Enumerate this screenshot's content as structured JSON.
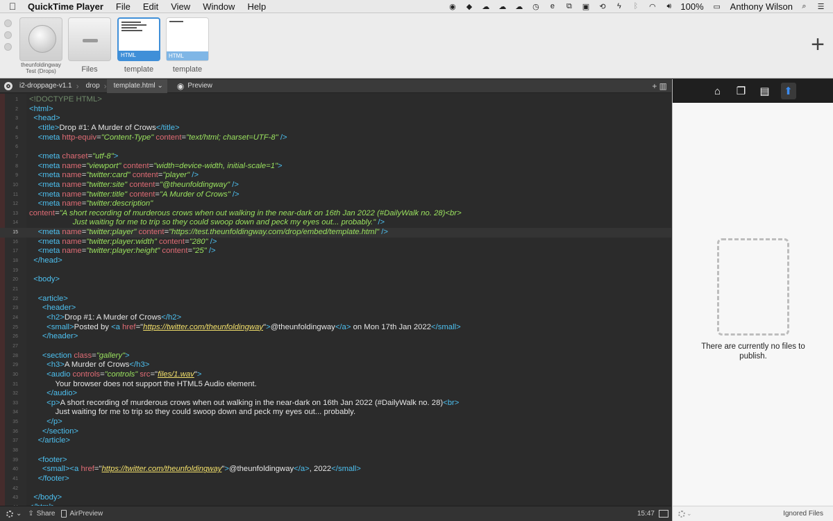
{
  "menubar": {
    "app_name": "QuickTime Player",
    "menus": [
      "File",
      "Edit",
      "View",
      "Window",
      "Help"
    ],
    "battery": "100%",
    "user": "Anthony Wilson"
  },
  "strip": {
    "tiles": [
      {
        "caption": "theunfoldingway\nTest (Drops)",
        "icon": "globe-icon"
      },
      {
        "caption": "Files",
        "icon": "files-box-icon"
      },
      {
        "caption": "template",
        "badge": "HTML",
        "icon": "html-doc-icon",
        "selected": true
      },
      {
        "caption": "template",
        "badge": "HTML",
        "icon": "html-doc-icon",
        "selected": false
      }
    ]
  },
  "editor_bar": {
    "crumbs": [
      "i2-droppage-v1.1",
      "drop",
      "template.html"
    ],
    "preview": "Preview"
  },
  "code": {
    "current_line": 15,
    "lines": [
      [
        [
          "c",
          "<!DOCTYPE HTML>"
        ]
      ],
      [
        [
          "t",
          "<html>"
        ]
      ],
      [
        [
          "x",
          "  "
        ],
        [
          "t",
          "<head>"
        ]
      ],
      [
        [
          "x",
          "    "
        ],
        [
          "t",
          "<title>"
        ],
        [
          "x",
          "Drop #1: A Murder of Crows"
        ],
        [
          "t",
          "</title>"
        ]
      ],
      [
        [
          "x",
          "    "
        ],
        [
          "t",
          "<meta "
        ],
        [
          "a",
          "http-equiv"
        ],
        [
          "x",
          "="
        ],
        [
          "v",
          "\"Content-Type\""
        ],
        [
          "x",
          " "
        ],
        [
          "a",
          "content"
        ],
        [
          "x",
          "="
        ],
        [
          "v",
          "\"text/html; charset=UTF-8\""
        ],
        [
          "t",
          " />"
        ]
      ],
      [],
      [
        [
          "x",
          "    "
        ],
        [
          "t",
          "<meta "
        ],
        [
          "a",
          "charset"
        ],
        [
          "x",
          "="
        ],
        [
          "v",
          "\"utf-8\""
        ],
        [
          "t",
          ">"
        ]
      ],
      [
        [
          "x",
          "    "
        ],
        [
          "t",
          "<meta "
        ],
        [
          "a",
          "name"
        ],
        [
          "x",
          "="
        ],
        [
          "v",
          "\"viewport\""
        ],
        [
          "x",
          " "
        ],
        [
          "a",
          "content"
        ],
        [
          "x",
          "="
        ],
        [
          "v",
          "\"width=device-width, initial-scale=1\""
        ],
        [
          "t",
          ">"
        ]
      ],
      [
        [
          "x",
          "    "
        ],
        [
          "t",
          "<meta "
        ],
        [
          "a",
          "name"
        ],
        [
          "x",
          "="
        ],
        [
          "v",
          "\"twitter:card\""
        ],
        [
          "x",
          " "
        ],
        [
          "a",
          "content"
        ],
        [
          "x",
          "="
        ],
        [
          "v",
          "\"player\""
        ],
        [
          "t",
          " />"
        ]
      ],
      [
        [
          "x",
          "    "
        ],
        [
          "t",
          "<meta "
        ],
        [
          "a",
          "name"
        ],
        [
          "x",
          "="
        ],
        [
          "v",
          "\"twitter:site\""
        ],
        [
          "x",
          " "
        ],
        [
          "a",
          "content"
        ],
        [
          "x",
          "="
        ],
        [
          "v",
          "\"@theunfoldingway\""
        ],
        [
          "t",
          " />"
        ]
      ],
      [
        [
          "x",
          "    "
        ],
        [
          "t",
          "<meta "
        ],
        [
          "a",
          "name"
        ],
        [
          "x",
          "="
        ],
        [
          "v",
          "\"twitter:title\""
        ],
        [
          "x",
          " "
        ],
        [
          "a",
          "content"
        ],
        [
          "x",
          "="
        ],
        [
          "v",
          "\"A Murder of Crows\""
        ],
        [
          "t",
          " />"
        ]
      ],
      [
        [
          "x",
          "    "
        ],
        [
          "t",
          "<meta "
        ],
        [
          "a",
          "name"
        ],
        [
          "x",
          "="
        ],
        [
          "v",
          "\"twitter:description\""
        ]
      ],
      [
        [
          "a",
          "content"
        ],
        [
          "x",
          "="
        ],
        [
          "v",
          "\"A short recording of murderous crows when out walking in the near-dark on 16th Jan 2022 (#DailyWalk no. 28)<br>"
        ]
      ],
      [
        [
          "v",
          "                    Just waiting for me to trip so they could swoop down and peck my eyes out... probably.\""
        ],
        [
          "t",
          " />"
        ]
      ],
      [
        [
          "x",
          "    "
        ],
        [
          "t",
          "<meta "
        ],
        [
          "a",
          "name"
        ],
        [
          "x",
          "="
        ],
        [
          "v",
          "\"twitter:player\""
        ],
        [
          "x",
          " "
        ],
        [
          "a",
          "content"
        ],
        [
          "x",
          "="
        ],
        [
          "v",
          "\"https://test.theunfoldingway.com/drop/embed/template.html\""
        ],
        [
          "t",
          " />"
        ]
      ],
      [
        [
          "x",
          "    "
        ],
        [
          "t",
          "<meta "
        ],
        [
          "a",
          "name"
        ],
        [
          "x",
          "="
        ],
        [
          "v",
          "\"twitter:player:width\""
        ],
        [
          "x",
          " "
        ],
        [
          "a",
          "content"
        ],
        [
          "x",
          "="
        ],
        [
          "v",
          "\"280\""
        ],
        [
          "t",
          " />"
        ]
      ],
      [
        [
          "x",
          "    "
        ],
        [
          "t",
          "<meta "
        ],
        [
          "a",
          "name"
        ],
        [
          "x",
          "="
        ],
        [
          "v",
          "\"twitter:player:height\""
        ],
        [
          "x",
          " "
        ],
        [
          "a",
          "content"
        ],
        [
          "x",
          "="
        ],
        [
          "v",
          "\"25\""
        ],
        [
          "t",
          " />"
        ]
      ],
      [
        [
          "x",
          "  "
        ],
        [
          "t",
          "</head>"
        ]
      ],
      [],
      [
        [
          "x",
          "  "
        ],
        [
          "t",
          "<body>"
        ]
      ],
      [],
      [
        [
          "x",
          "    "
        ],
        [
          "t",
          "<article>"
        ]
      ],
      [
        [
          "x",
          "      "
        ],
        [
          "t",
          "<header>"
        ]
      ],
      [
        [
          "x",
          "        "
        ],
        [
          "t",
          "<h2>"
        ],
        [
          "x",
          "Drop #1: A Murder of Crows"
        ],
        [
          "t",
          "</h2>"
        ]
      ],
      [
        [
          "x",
          "        "
        ],
        [
          "t",
          "<small>"
        ],
        [
          "x",
          "Posted by "
        ],
        [
          "t",
          "<a "
        ],
        [
          "a",
          "href"
        ],
        [
          "x",
          "=\""
        ],
        [
          "u",
          "https://twitter.com/theunfoldingway"
        ],
        [
          "x",
          "\""
        ],
        [
          "t",
          ">"
        ],
        [
          "x",
          "@theunfoldingway"
        ],
        [
          "t",
          "</a>"
        ],
        [
          "x",
          " on Mon 17th Jan 2022"
        ],
        [
          "t",
          "</small>"
        ]
      ],
      [
        [
          "x",
          "      "
        ],
        [
          "t",
          "</header>"
        ]
      ],
      [],
      [
        [
          "x",
          "      "
        ],
        [
          "t",
          "<section "
        ],
        [
          "a",
          "class"
        ],
        [
          "x",
          "="
        ],
        [
          "v",
          "\"gallery\""
        ],
        [
          "t",
          ">"
        ]
      ],
      [
        [
          "x",
          "        "
        ],
        [
          "t",
          "<h3>"
        ],
        [
          "x",
          "A Murder of Crows"
        ],
        [
          "t",
          "</h3>"
        ]
      ],
      [
        [
          "x",
          "        "
        ],
        [
          "t",
          "<audio "
        ],
        [
          "a",
          "controls"
        ],
        [
          "x",
          "="
        ],
        [
          "v",
          "\"controls\""
        ],
        [
          "x",
          " "
        ],
        [
          "a",
          "src"
        ],
        [
          "x",
          "=\""
        ],
        [
          "u",
          "files/1.wav"
        ],
        [
          "x",
          "\""
        ],
        [
          "t",
          ">"
        ]
      ],
      [
        [
          "x",
          "            Your browser does not support the HTML5 Audio element."
        ]
      ],
      [
        [
          "x",
          "        "
        ],
        [
          "t",
          "</audio>"
        ]
      ],
      [
        [
          "x",
          "        "
        ],
        [
          "t",
          "<p>"
        ],
        [
          "x",
          "A short recording of murderous crows when out walking in the near-dark on 16th Jan 2022 (#DailyWalk no. 28)"
        ],
        [
          "t",
          "<br>"
        ]
      ],
      [
        [
          "x",
          "            Just waiting for me to trip so they could swoop down and peck my eyes out... probably."
        ]
      ],
      [
        [
          "x",
          "        "
        ],
        [
          "t",
          "</p>"
        ]
      ],
      [
        [
          "x",
          "      "
        ],
        [
          "t",
          "</section>"
        ]
      ],
      [
        [
          "x",
          "    "
        ],
        [
          "t",
          "</article>"
        ]
      ],
      [],
      [
        [
          "x",
          "    "
        ],
        [
          "t",
          "<footer>"
        ]
      ],
      [
        [
          "x",
          "      "
        ],
        [
          "t",
          "<small>"
        ],
        [
          "t",
          "<a "
        ],
        [
          "a",
          "href"
        ],
        [
          "x",
          "=\""
        ],
        [
          "u",
          "https://twitter.com/theunfoldingway"
        ],
        [
          "x",
          "\""
        ],
        [
          "t",
          ">"
        ],
        [
          "x",
          "@theunfoldingway"
        ],
        [
          "t",
          "</a>"
        ],
        [
          "x",
          ", 2022"
        ],
        [
          "t",
          "</small>"
        ]
      ],
      [
        [
          "x",
          "    "
        ],
        [
          "t",
          "</footer>"
        ]
      ],
      [],
      [
        [
          "x",
          "  "
        ],
        [
          "t",
          "</body>"
        ]
      ],
      [
        [
          "t",
          "</html>"
        ]
      ]
    ]
  },
  "status": {
    "share": "Share",
    "airpreview": "AirPreview",
    "time": "15:47"
  },
  "publish_panel": {
    "empty_message": "There are currently no files to publish.",
    "ignored_files": "Ignored Files"
  }
}
